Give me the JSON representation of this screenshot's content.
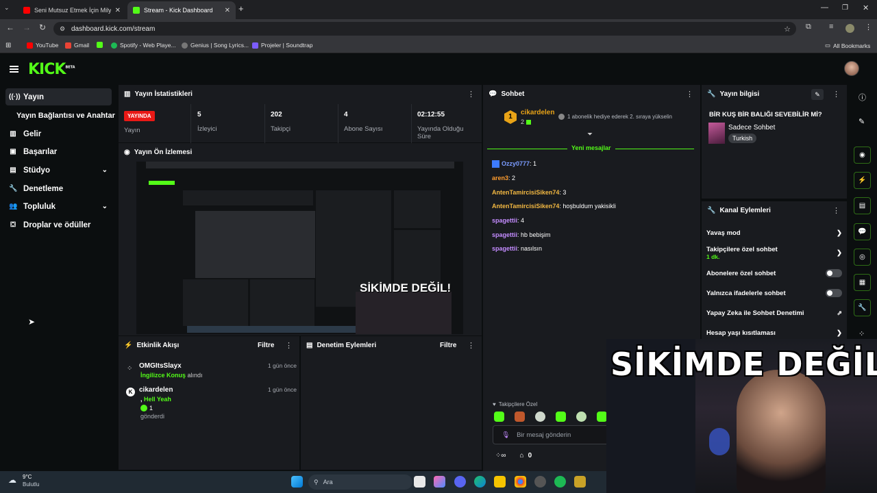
{
  "browser": {
    "tabs": [
      {
        "title": "Seni Mutsuz Etmek İçin Milyarla",
        "favicon_color": "#ff0000"
      },
      {
        "title": "Stream - Kick Dashboard",
        "favicon_color": "#53fc18"
      }
    ],
    "address": "dashboard.kick.com/stream",
    "bookmarks": [
      {
        "label": "YouTube",
        "color": "#ff0000"
      },
      {
        "label": "Gmail",
        "color": "#ea4335"
      },
      {
        "label": "",
        "color": "#53fc18"
      },
      {
        "label": "Spotify - Web Playe...",
        "color": "#1db954"
      },
      {
        "label": "Genius | Song Lyrics...",
        "color": "#777777"
      },
      {
        "label": "Projeler | Soundtrap",
        "color": "#7c5cff"
      }
    ],
    "all_bookmarks": "All Bookmarks"
  },
  "kick": {
    "logo": "KICK",
    "logo_badge": "BETA",
    "brand_color": "#53fc18"
  },
  "sidebar": {
    "items": [
      {
        "label": "Yayın",
        "icon": "broadcast-icon"
      },
      {
        "label": "Yayın Bağlantısı ve Anahtarı"
      },
      {
        "label": "Gelir",
        "icon": "bar-chart-icon"
      },
      {
        "label": "Başarılar",
        "icon": "trophy-icon"
      },
      {
        "label": "Stüdyo",
        "icon": "studio-icon"
      },
      {
        "label": "Denetleme",
        "icon": "wrench-icon"
      },
      {
        "label": "Topluluk",
        "icon": "people-icon"
      },
      {
        "label": "Droplar ve ödüller",
        "icon": "gift-icon"
      }
    ]
  },
  "stats": {
    "title": "Yayın İstatistikleri",
    "live_badge": "YAYINDA",
    "live_label": "Yayın",
    "items": [
      {
        "value": "5",
        "label": "İzleyici"
      },
      {
        "value": "202",
        "label": "Takipçi"
      },
      {
        "value": "4",
        "label": "Abone Sayısı"
      },
      {
        "value": "02:12:55",
        "label": "Yayında Olduğu Süre"
      }
    ]
  },
  "preview": {
    "title": "Yayın Ön İzlemesi",
    "overlay_text": "SİKİMDE DEĞİL!"
  },
  "activity": {
    "title": "Etkinlik Akışı",
    "filter": "Filtre",
    "events": [
      {
        "user": "OMGItsSlayx",
        "detail_green": "İngilizce Konuş",
        "detail_rest": " alındı",
        "time": "1 gün önce"
      },
      {
        "user": "cikardelen",
        "detail_green": "Hell Yeah",
        "detail_prefix": ", ",
        "count": "1",
        "sent": "gönderdi",
        "time": "1 gün önce"
      }
    ]
  },
  "mod_actions": {
    "title": "Denetim Eylemleri",
    "filter": "Filtre"
  },
  "chat": {
    "title": "Sohbet",
    "top_user": "cikardelen",
    "top_rank": "1",
    "top_count": "2",
    "gift_text": "1 abonelik hediye ederek 2. sıraya yükselin",
    "new_messages": "Yeni mesajlar",
    "messages": [
      {
        "user": "Ozzy0777",
        "text": ": 1",
        "color": "#7b9cff"
      },
      {
        "user": "aren3",
        "text": ": 2",
        "color": "#ff9d2e"
      },
      {
        "user": "AntenTamircisiSiken74",
        "text": ": 3",
        "color": "#f4b942"
      },
      {
        "user": "AntenTamircisiSiken74",
        "text": ": hoşbuldum yakisikli",
        "color": "#f4b942"
      },
      {
        "user": "spagettii",
        "text": ": 4",
        "color": "#c48cff"
      },
      {
        "user": "spagettii",
        "text": ": hb bebişim",
        "color": "#c48cff"
      },
      {
        "user": "spagettii",
        "text": ": nasılsın",
        "color": "#c48cff"
      }
    ],
    "followers_only": "Takipçilere Özel",
    "input_placeholder": "Bir mesaj gönderin",
    "footer_count": "0"
  },
  "stream_info": {
    "title": "Yayın bilgisi",
    "stream_title": "BİR KUŞ BİR BALIĞI SEVEBİLİR Mİ?",
    "category": "Sadece Sohbet",
    "language": "Turkish"
  },
  "channel_actions": {
    "title": "Kanal Eylemleri",
    "items": [
      {
        "label": "Yavaş mod"
      },
      {
        "label": "Takipçilere özel sohbet",
        "sub": "1 dk."
      },
      {
        "label": "Abonelere özel sohbet"
      },
      {
        "label": "Yalnızca ifadelerle sohbet"
      },
      {
        "label": "Yapay Zeka ile Sohbet Denetimi"
      },
      {
        "label": "Hesap yaşı kısıtlaması"
      }
    ]
  },
  "webcam": {
    "overlay_text": "SİKİMDE DEĞİL!"
  },
  "taskbar": {
    "temperature": "9°C",
    "weather": "Bulutlu",
    "search": "Ara"
  }
}
